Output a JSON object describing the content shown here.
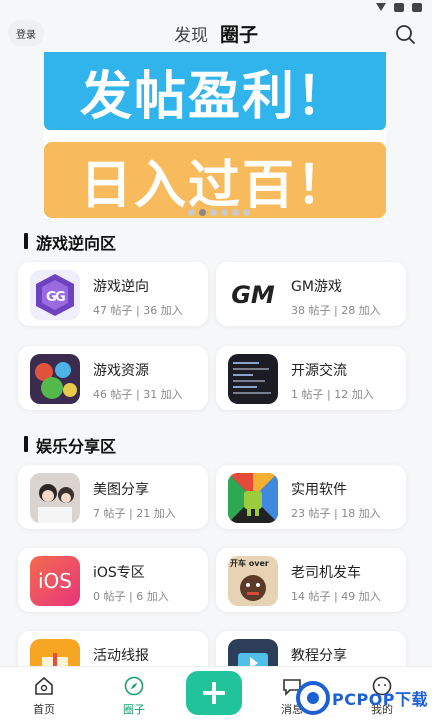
{
  "header": {
    "login_label": "登录",
    "tabs": [
      "发现",
      "圈子"
    ],
    "active_tab": "圈子"
  },
  "banner": {
    "line1": "发帖盈利！",
    "line2": "日入过百！",
    "page_count": 6,
    "active_dot": 2
  },
  "sections": [
    {
      "title": "游戏逆向区",
      "items": [
        {
          "name": "游戏逆向",
          "meta": "47 帖子 | 36 加入",
          "icon": "gameguardian-icon"
        },
        {
          "name": "GM游戏",
          "meta": "38 帖子 | 28 加入",
          "icon": "gm-logo-icon"
        },
        {
          "name": "游戏资源",
          "meta": "46 帖子 | 31 加入",
          "icon": "game-art-icon"
        },
        {
          "name": "开源交流",
          "meta": "1 帖子 | 12 加入",
          "icon": "code-screen-icon"
        }
      ]
    },
    {
      "title": "娱乐分享区",
      "items": [
        {
          "name": "美图分享",
          "meta": "7 帖子 | 21 加入",
          "icon": "photo-icon"
        },
        {
          "name": "实用软件",
          "meta": "23 帖子 | 18 加入",
          "icon": "android-icon"
        },
        {
          "name": "iOS专区",
          "meta": "0 帖子 | 6 加入",
          "icon": "ios-icon"
        },
        {
          "name": "老司机发车",
          "meta": "14 帖子 | 49 加入",
          "icon": "meme-icon"
        },
        {
          "name": "活动线报",
          "meta": "",
          "icon": "gift-icon"
        },
        {
          "name": "教程分享",
          "meta": "",
          "icon": "video-icon"
        }
      ]
    }
  ],
  "gm_logo_text": "GM",
  "ios_logo_text": "iOS",
  "meme_text": "开车 over",
  "tabbar": {
    "items": [
      "首页",
      "圈子",
      "消息",
      "我的"
    ],
    "active": "圈子"
  },
  "watermark": {
    "text": "PCPOP下载"
  },
  "colors": {
    "accent": "#20c39a",
    "active_tab": "#1aa16e",
    "banner_blue": "#31b4ec",
    "banner_orange": "#f7bb5e",
    "watermark_blue": "#1c60d6"
  }
}
